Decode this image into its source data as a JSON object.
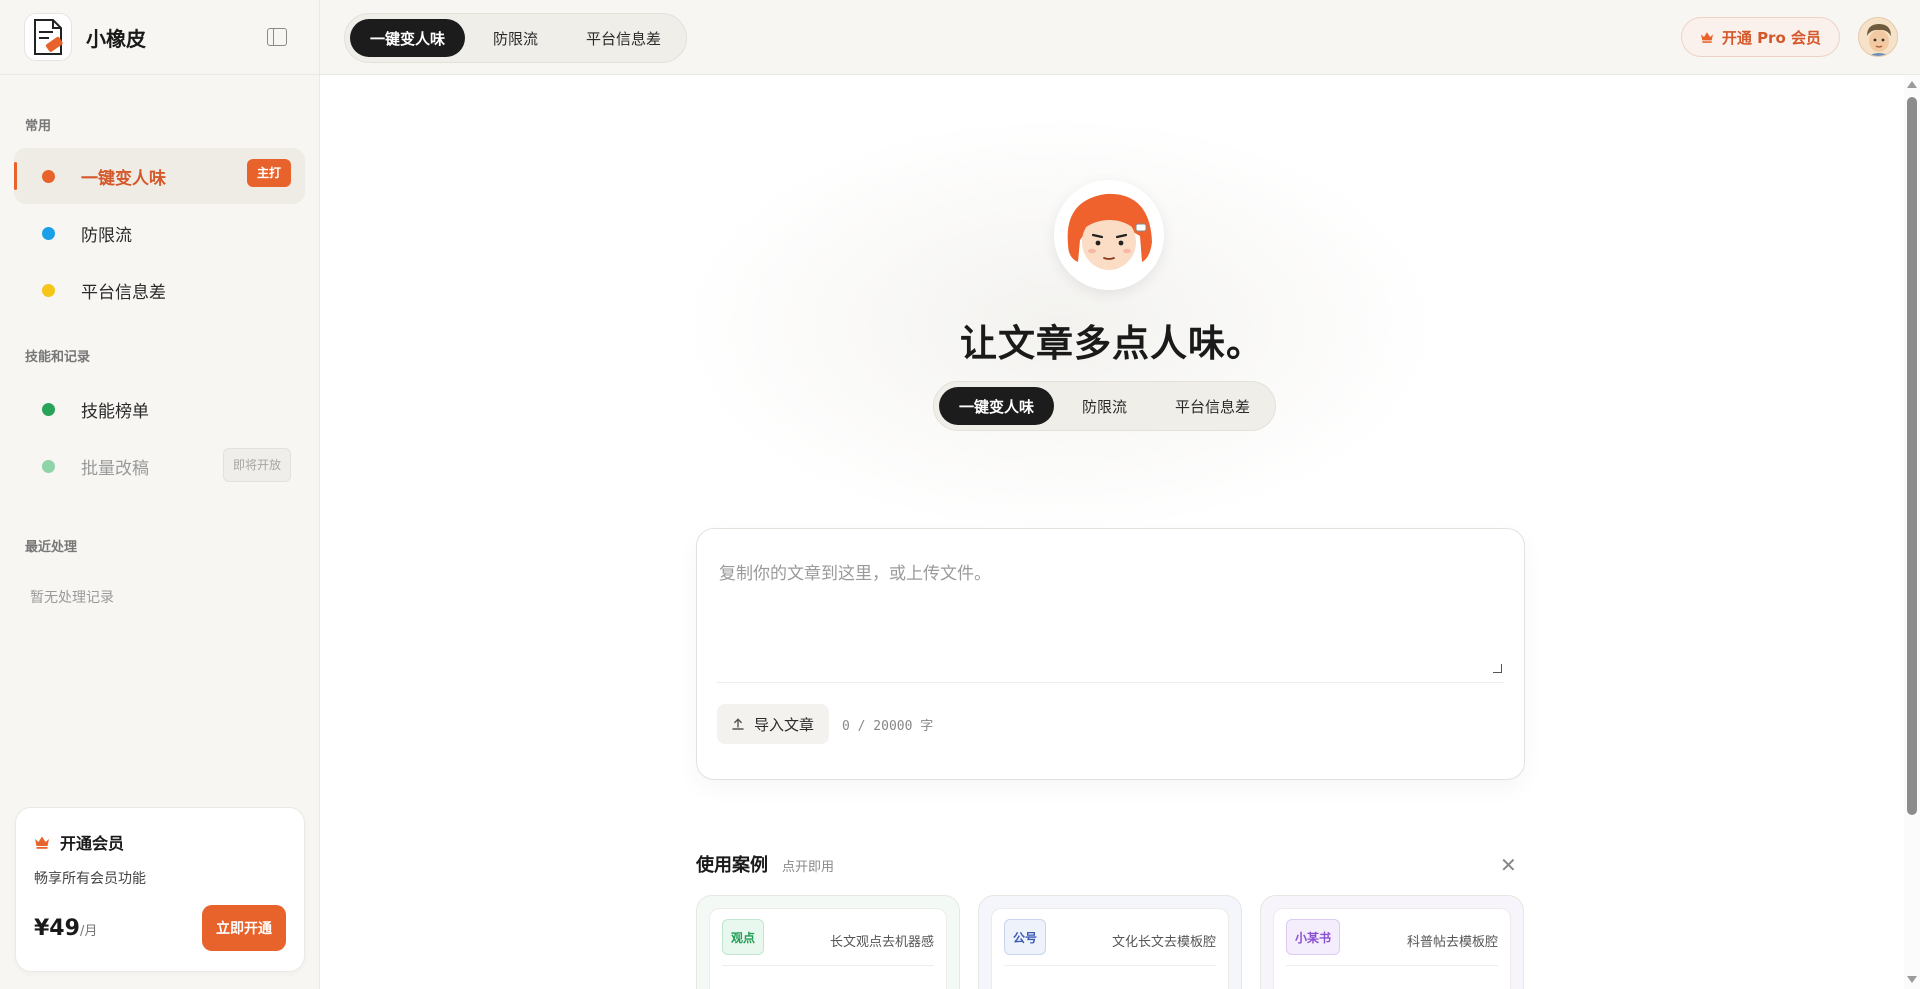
{
  "brand": {
    "name": "小橡皮"
  },
  "sidebar": {
    "sections": [
      {
        "title": "常用"
      },
      {
        "title": "技能和记录"
      },
      {
        "title": "最近处理"
      }
    ],
    "items": [
      {
        "label": "一键变人味",
        "badge": "主打",
        "color": "#e8632c"
      },
      {
        "label": "防限流",
        "color": "#1aa0e8"
      },
      {
        "label": "平台信息差",
        "color": "#f5c518"
      },
      {
        "label": "技能榜单",
        "color": "#27a35a"
      },
      {
        "label": "批量改稿",
        "badge": "即将开放",
        "color": "#8ed4a6"
      }
    ],
    "recent_empty": "暂无处理记录",
    "member": {
      "title": "开通会员",
      "desc": "畅享所有会员功能",
      "price": "¥49",
      "unit": "/月",
      "button": "立即开通"
    }
  },
  "topbar": {
    "tabs": [
      "一键变人味",
      "防限流",
      "平台信息差"
    ],
    "pro_label": "开通 Pro 会员"
  },
  "main": {
    "title": "让文章多点人味。",
    "tabs": [
      "一键变人味",
      "防限流",
      "平台信息差"
    ],
    "editor": {
      "placeholder": "复制你的文章到这里，或上传文件。",
      "import_label": "导入文章",
      "counter": "0 / 20000 字"
    },
    "cases": {
      "title": "使用案例",
      "subtitle": "点开即用",
      "items": [
        {
          "tag": "观点",
          "label": "长文观点去机器感",
          "tag_color": "#1f9d55",
          "tag_bg": "#e9f8ef"
        },
        {
          "tag": "公号",
          "label": "文化长文去模板腔",
          "tag_color": "#3b5bb5",
          "tag_bg": "#eef2fb"
        },
        {
          "tag": "小某书",
          "label": "科普帖去模板腔",
          "tag_color": "#8a4fd1",
          "tag_bg": "#f4eefc"
        }
      ]
    }
  },
  "colors": {
    "accent": "#e8632c",
    "dark": "#1c1c1c"
  }
}
